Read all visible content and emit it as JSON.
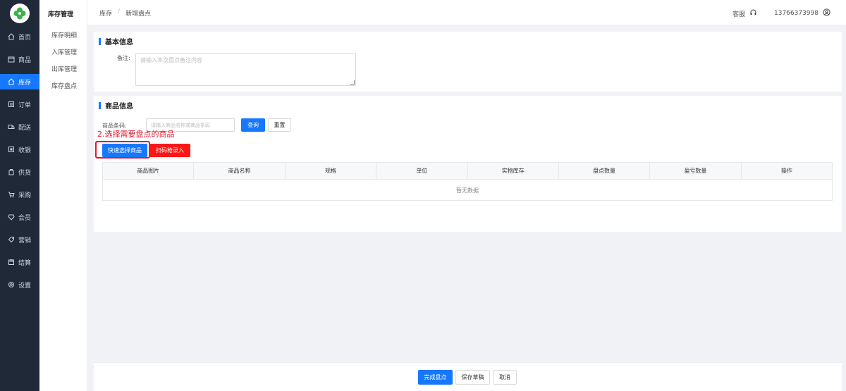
{
  "sidebar": {
    "items": [
      {
        "label": "首页",
        "icon": "home-icon"
      },
      {
        "label": "商品",
        "icon": "goods-icon"
      },
      {
        "label": "库存",
        "icon": "inventory-icon",
        "active": true
      },
      {
        "label": "订单",
        "icon": "order-icon"
      },
      {
        "label": "配送",
        "icon": "delivery-icon"
      },
      {
        "label": "收银",
        "icon": "cashier-icon"
      },
      {
        "label": "供货",
        "icon": "supply-icon"
      },
      {
        "label": "采购",
        "icon": "cart-icon"
      },
      {
        "label": "会员",
        "icon": "member-icon"
      },
      {
        "label": "营销",
        "icon": "marketing-icon"
      },
      {
        "label": "结算",
        "icon": "settlement-icon"
      },
      {
        "label": "设置",
        "icon": "settings-icon"
      }
    ]
  },
  "subnav": {
    "title": "库存管理",
    "items": [
      "库存明细",
      "入库管理",
      "出库管理",
      "库存盘点"
    ]
  },
  "header": {
    "breadcrumb": [
      "库存",
      "新增盘点"
    ],
    "service_label": "客服",
    "phone": "13766373998"
  },
  "basic_info": {
    "title": "基本信息",
    "remark_label": "备注:",
    "remark_placeholder": "请输入本次盘点备注内容"
  },
  "goods_info": {
    "title": "商品信息",
    "barcode_label": "商品条码:",
    "barcode_placeholder": "请输入商品名称或商品条码",
    "query_button": "查询",
    "reset_button": "重置",
    "annotation": "2.选择需要盘点的商品",
    "quick_select_button": "快速选择商品",
    "scan_button": "扫码枪录入",
    "columns": [
      "商品图片",
      "商品名称",
      "规格",
      "单位",
      "实物库存",
      "盘点数量",
      "盈亏数量",
      "操作"
    ],
    "empty_text": "暂无数据"
  },
  "footer": {
    "complete_button": "完成盘点",
    "save_draft_button": "保存草稿",
    "cancel_button": "取消"
  },
  "colors": {
    "primary": "#1677ff",
    "danger": "#ff1616",
    "annotation": "#e0182f",
    "sidebar_bg": "#1f2937"
  }
}
